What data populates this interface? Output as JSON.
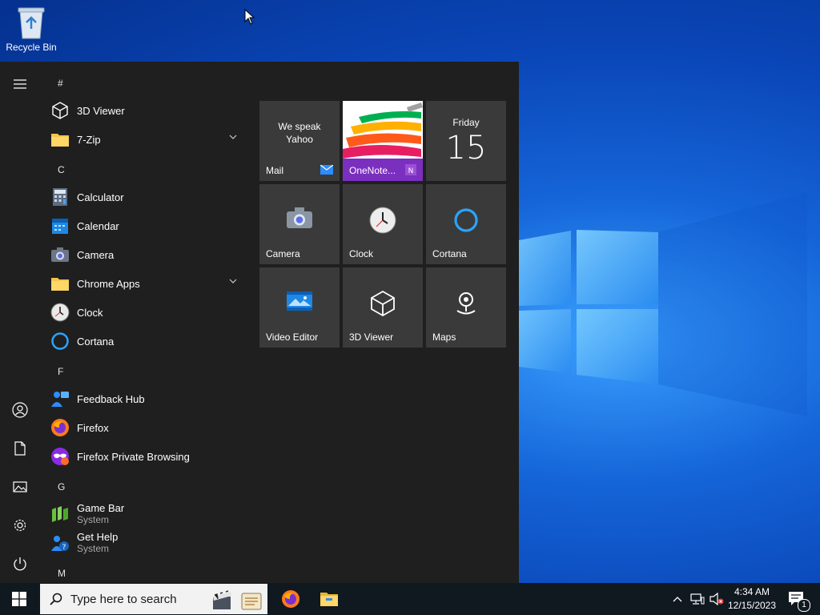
{
  "desktop": {
    "recycle_bin_label": "Recycle Bin"
  },
  "start_menu": {
    "groups": [
      {
        "letter": "#"
      },
      {
        "letter": "C"
      },
      {
        "letter": "F"
      },
      {
        "letter": "G"
      },
      {
        "letter": "M"
      }
    ],
    "apps": [
      {
        "label": "3D Viewer",
        "icon": "3d-viewer-icon"
      },
      {
        "label": "7-Zip",
        "icon": "folder-icon"
      },
      {
        "label": "Calculator",
        "icon": "calculator-icon"
      },
      {
        "label": "Calendar",
        "icon": "calendar-icon"
      },
      {
        "label": "Camera",
        "icon": "camera-icon"
      },
      {
        "label": "Chrome Apps",
        "icon": "folder-icon"
      },
      {
        "label": "Clock",
        "icon": "clock-icon"
      },
      {
        "label": "Cortana",
        "icon": "cortana-icon"
      },
      {
        "label": "Feedback Hub",
        "icon": "feedback-hub-icon"
      },
      {
        "label": "Firefox",
        "icon": "firefox-icon"
      },
      {
        "label": "Firefox Private Browsing",
        "icon": "firefox-private-icon"
      },
      {
        "label": "Game Bar",
        "sub": "System",
        "icon": "game-bar-icon"
      },
      {
        "label": "Get Help",
        "sub": "System",
        "icon": "get-help-icon"
      }
    ],
    "tiles": {
      "mail": {
        "label": "Mail",
        "text1": "We speak",
        "text2": "Yahoo"
      },
      "onenote": {
        "label": "OneNote..."
      },
      "calendar": {
        "label": "Friday",
        "day": "15"
      },
      "camera": {
        "label": "Camera"
      },
      "clock": {
        "label": "Clock"
      },
      "cortana": {
        "label": "Cortana"
      },
      "video_editor": {
        "label": "Video Editor"
      },
      "viewer_3d": {
        "label": "3D Viewer"
      },
      "maps": {
        "label": "Maps"
      }
    }
  },
  "taskbar": {
    "search_placeholder": "Type here to search",
    "time": "4:34 AM",
    "date": "12/15/2023",
    "notification_count": "1"
  },
  "colors": {
    "accent": "#0078d7",
    "start_bg": "#1f1f1f",
    "tile_bg": "#3a3a3a",
    "taskbar_bg": "#101820"
  }
}
